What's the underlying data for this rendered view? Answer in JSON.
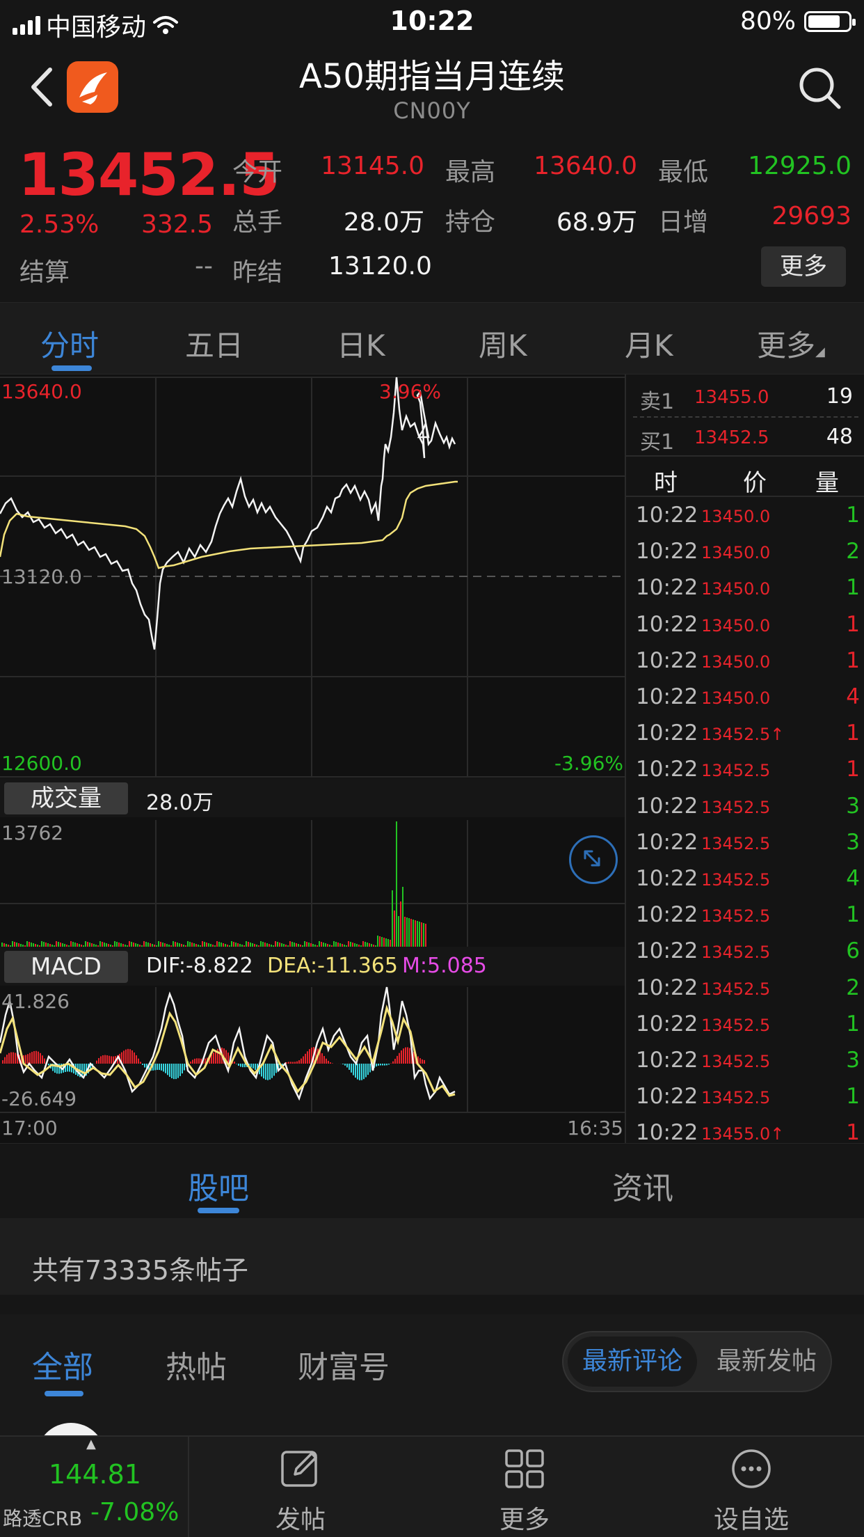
{
  "status_bar": {
    "carrier": "中国移动",
    "time": "10:22",
    "battery": "80%",
    "battery_level": 0.8
  },
  "nav": {
    "title": "A50期指当月连续",
    "subtitle": "CN00Y"
  },
  "quote": {
    "price": "13452.5",
    "change_pct": "2.53%",
    "change": "332.5",
    "settle_label": "结算",
    "settle_value": "--",
    "open_label": "今开",
    "open_value": "13145.0",
    "high_label": "最高",
    "high_value": "13640.0",
    "low_label": "最低",
    "low_value": "12925.0",
    "volume_label": "总手",
    "volume_value": "28.0万",
    "oi_label": "持仓",
    "oi_value": "68.9万",
    "daily_inc_label": "日增",
    "daily_inc_value": "29693",
    "prev_settle_label": "昨结",
    "prev_settle_value": "13120.0",
    "more_label": "更多"
  },
  "period_tabs": [
    "分时",
    "五日",
    "日K",
    "周K",
    "月K",
    "更多"
  ],
  "chart": {
    "price_high": "13640.0",
    "price_mid": "13120.0",
    "price_low": "12600.0",
    "pct_high": "3.96%",
    "pct_low": "-3.96%",
    "volume_label": "成交量",
    "volume_value": "28.0万",
    "volume_max": "13762",
    "macd_label": "MACD",
    "dif": "DIF:-8.822",
    "dea": "DEA:-11.365",
    "m": "M:5.085",
    "macd_max": "41.826",
    "macd_min": "-26.649",
    "time_start": "17:00",
    "time_end": "16:35"
  },
  "order_book": {
    "sell": {
      "label": "卖1",
      "price": "13455.0",
      "qty": "19"
    },
    "buy": {
      "label": "买1",
      "price": "13452.5",
      "qty": "48"
    },
    "headers": [
      "时",
      "价",
      "量"
    ]
  },
  "ticks": [
    {
      "time": "10:22",
      "price": "13450.0",
      "vol": "1",
      "dir": "green"
    },
    {
      "time": "10:22",
      "price": "13450.0",
      "vol": "2",
      "dir": "green"
    },
    {
      "time": "10:22",
      "price": "13450.0",
      "vol": "1",
      "dir": "green"
    },
    {
      "time": "10:22",
      "price": "13450.0",
      "vol": "1",
      "dir": "red"
    },
    {
      "time": "10:22",
      "price": "13450.0",
      "vol": "1",
      "dir": "red"
    },
    {
      "time": "10:22",
      "price": "13450.0",
      "vol": "4",
      "dir": "red"
    },
    {
      "time": "10:22",
      "price": "13452.5↑",
      "vol": "1",
      "dir": "red"
    },
    {
      "time": "10:22",
      "price": "13452.5",
      "vol": "1",
      "dir": "red"
    },
    {
      "time": "10:22",
      "price": "13452.5",
      "vol": "3",
      "dir": "green"
    },
    {
      "time": "10:22",
      "price": "13452.5",
      "vol": "3",
      "dir": "green"
    },
    {
      "time": "10:22",
      "price": "13452.5",
      "vol": "4",
      "dir": "green"
    },
    {
      "time": "10:22",
      "price": "13452.5",
      "vol": "1",
      "dir": "green"
    },
    {
      "time": "10:22",
      "price": "13452.5",
      "vol": "6",
      "dir": "green"
    },
    {
      "time": "10:22",
      "price": "13452.5",
      "vol": "2",
      "dir": "green"
    },
    {
      "time": "10:22",
      "price": "13452.5",
      "vol": "1",
      "dir": "green"
    },
    {
      "time": "10:22",
      "price": "13452.5",
      "vol": "3",
      "dir": "green"
    },
    {
      "time": "10:22",
      "price": "13452.5",
      "vol": "1",
      "dir": "green"
    },
    {
      "time": "10:22",
      "price": "13455.0↑",
      "vol": "1",
      "dir": "red"
    }
  ],
  "community_tabs": [
    "股吧",
    "资讯"
  ],
  "post_count": "共有73335条帖子",
  "filter_tabs": [
    "全部",
    "热帖",
    "财富号"
  ],
  "sort_options": [
    "最新评论",
    "最新发帖"
  ],
  "bottom_bar": {
    "ticker_value": "144.81",
    "ticker_name": "路透CRB",
    "ticker_change": "-7.08%",
    "post_label": "发帖",
    "more_label": "更多",
    "watch_label": "设自选"
  },
  "colors": {
    "up": "#e8232b",
    "down": "#22c322",
    "accent": "#3d86d8",
    "avg_line": "#f3e27a",
    "macd_neg": "#37d6e0"
  }
}
